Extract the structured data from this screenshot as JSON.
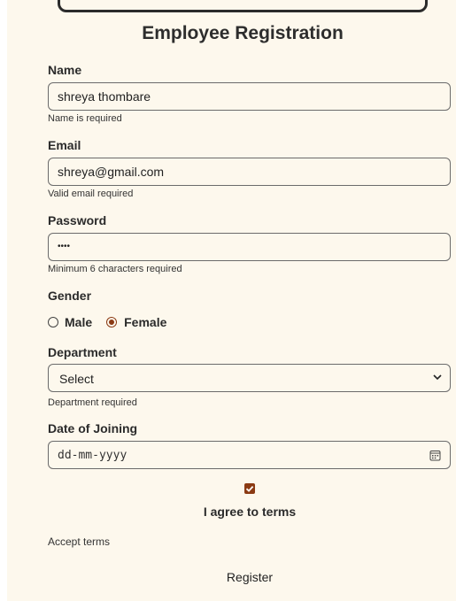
{
  "form": {
    "title": "Employee Registration",
    "name": {
      "label": "Name",
      "value": "shreya thombare",
      "error": "Name is required"
    },
    "email": {
      "label": "Email",
      "value": "shreya@gmail.com",
      "error": "Valid email required"
    },
    "password": {
      "label": "Password",
      "masked_value": "••••",
      "error": "Minimum 6 characters required"
    },
    "gender": {
      "label": "Gender",
      "options": [
        "Male",
        "Female"
      ],
      "selected": "Female"
    },
    "department": {
      "label": "Department",
      "selected": "Select",
      "error": "Department required"
    },
    "date_of_joining": {
      "label": "Date of Joining",
      "placeholder": "dd-mm-yyyy"
    },
    "terms": {
      "checked": true,
      "label": "I agree to terms",
      "helper": "Accept terms"
    },
    "submit_label": "Register"
  },
  "colors": {
    "background": "#fdf8ed",
    "accent": "#8b3a13",
    "border": "#6b6b6b"
  },
  "icons": {
    "dropdown": "chevron-down-icon",
    "date": "calendar-icon",
    "checkbox": "checkmark-icon"
  }
}
